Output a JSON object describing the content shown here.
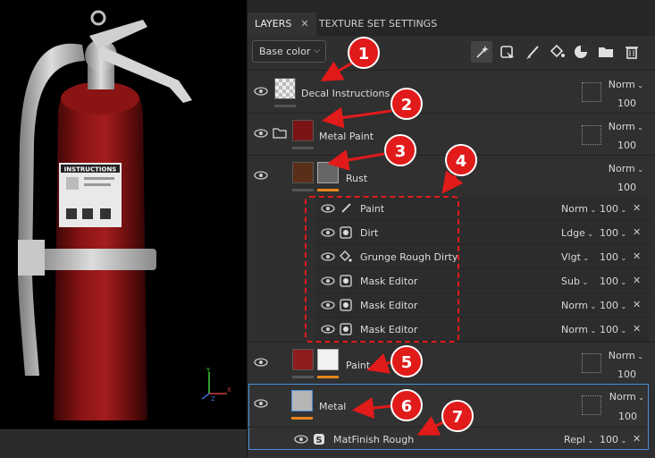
{
  "tabs": [
    {
      "label": "LAYERS",
      "close": "✕"
    },
    {
      "label": "TEXTURE SET SETTINGS"
    }
  ],
  "toolbar": {
    "channel_select": "Base color",
    "tools": [
      "magic-wand-icon",
      "fill-mask-icon",
      "brush-icon",
      "fill-bucket-icon",
      "smart-material-icon",
      "folder-icon",
      "trash-icon"
    ]
  },
  "layers": [
    {
      "name": "Decal Instructions",
      "blend": "Norm",
      "opacity": "100"
    },
    {
      "name": "Metal Paint",
      "blend": "Norm",
      "opacity": "100"
    },
    {
      "name": "Rust",
      "blend": "Norm",
      "opacity": "100"
    },
    {
      "name": "Paint",
      "blend": "Norm",
      "opacity": "100"
    },
    {
      "name": "Metal",
      "blend": "Norm",
      "opacity": "100"
    }
  ],
  "rust_effects": [
    {
      "name": "Paint",
      "blend": "Norm",
      "opacity": "100",
      "icon": "brush-icon"
    },
    {
      "name": "Dirt",
      "blend": "Ldge",
      "opacity": "100",
      "icon": "generator-icon"
    },
    {
      "name": "Grunge Rough Dirty",
      "blend": "Vlgt",
      "opacity": "100",
      "icon": "fill-bucket-icon"
    },
    {
      "name": "Mask Editor",
      "blend": "Sub",
      "opacity": "100",
      "icon": "generator-icon"
    },
    {
      "name": "Mask Editor",
      "blend": "Norm",
      "opacity": "100",
      "icon": "generator-icon"
    },
    {
      "name": "Mask Editor",
      "blend": "Norm",
      "opacity": "100",
      "icon": "generator-icon"
    }
  ],
  "metal_effect": {
    "name": "MatFinish Rough",
    "blend": "Repl",
    "opacity": "100",
    "icon": "substance-icon"
  },
  "decal": {
    "title": "INSTRUCTIONS"
  },
  "gizmo": {
    "y": "Y",
    "x": "X",
    "z": "Z"
  },
  "annotations": [
    "1",
    "2",
    "3",
    "4",
    "5",
    "6",
    "7"
  ],
  "colors": {
    "annotation": "#e11a1a",
    "accent": "#e8861a",
    "selection": "#4a90d9",
    "panel": "#2f2f2f"
  }
}
